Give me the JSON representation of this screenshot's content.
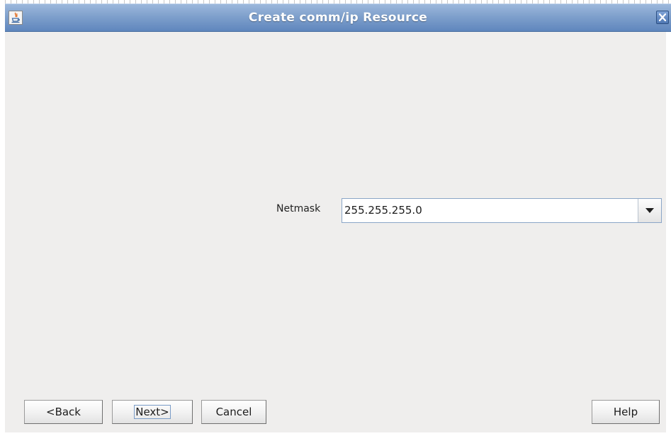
{
  "window": {
    "title": "Create comm/ip Resource"
  },
  "form": {
    "netmask_label": "Netmask",
    "netmask_value": "255.255.255.0"
  },
  "buttons": {
    "back_label": "<Back",
    "next_label": "Next>",
    "cancel_label": "Cancel",
    "help_label": "Help"
  },
  "icons": {
    "app": "java-icon",
    "close": "close-icon",
    "dropdown": "chevron-down-icon"
  },
  "colors": {
    "titlebar": "#7fa0cc",
    "content_background": "#efeeed",
    "field_border": "#8aa5c7"
  }
}
